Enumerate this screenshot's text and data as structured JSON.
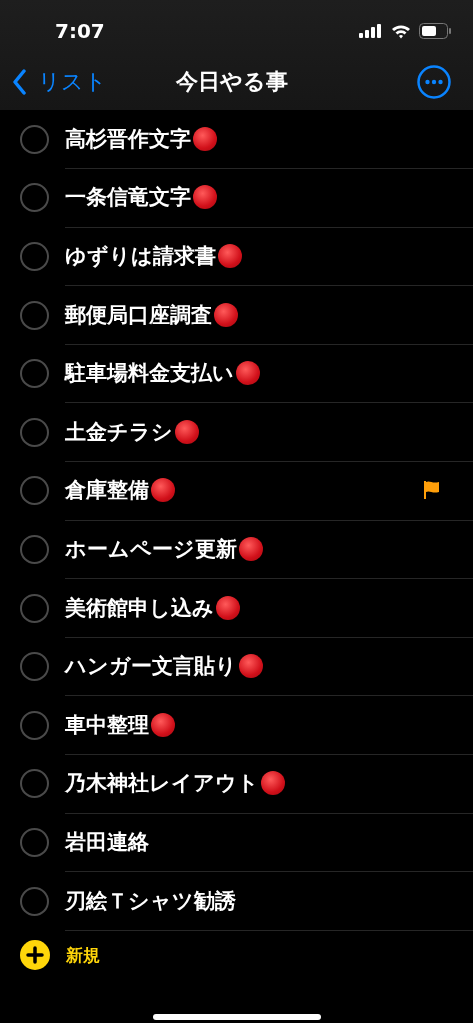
{
  "status_bar": {
    "time": "7:07"
  },
  "nav": {
    "back_label": "リスト",
    "title": "今日やる事"
  },
  "items": [
    {
      "title": "高杉晋作文字",
      "red_dot": true,
      "flagged": false,
      "completed": false
    },
    {
      "title": "一条信竜文字",
      "red_dot": true,
      "flagged": false,
      "completed": false
    },
    {
      "title": "ゆずりは請求書",
      "red_dot": true,
      "flagged": false,
      "completed": false
    },
    {
      "title": "郵便局口座調査",
      "red_dot": true,
      "flagged": false,
      "completed": false
    },
    {
      "title": "駐車場料金支払い",
      "red_dot": true,
      "flagged": false,
      "completed": false
    },
    {
      "title": "土金チラシ",
      "red_dot": true,
      "flagged": false,
      "completed": false
    },
    {
      "title": "倉庫整備",
      "red_dot": true,
      "flagged": true,
      "completed": false
    },
    {
      "title": "ホームページ更新",
      "red_dot": true,
      "flagged": false,
      "completed": false
    },
    {
      "title": "美術館申し込み",
      "red_dot": true,
      "flagged": false,
      "completed": false
    },
    {
      "title": "ハンガー文言貼り",
      "red_dot": true,
      "flagged": false,
      "completed": false
    },
    {
      "title": "車中整理",
      "red_dot": true,
      "flagged": false,
      "completed": false
    },
    {
      "title": "乃木神社レイアウト",
      "red_dot": true,
      "flagged": false,
      "completed": false
    },
    {
      "title": "岩田連絡",
      "red_dot": false,
      "flagged": false,
      "completed": false
    },
    {
      "title": "刃絵Ｔシャツ勧誘",
      "red_dot": false,
      "flagged": false,
      "completed": false
    }
  ],
  "new_button": {
    "label": "新規"
  }
}
